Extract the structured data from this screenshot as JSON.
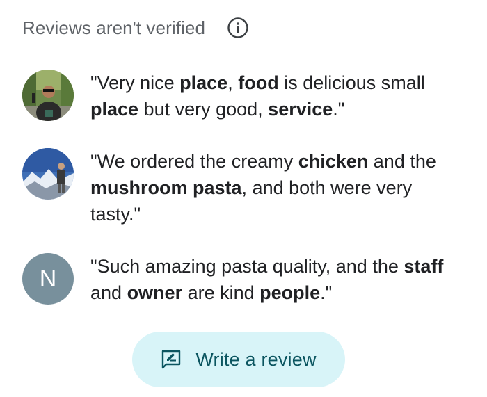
{
  "header": {
    "title": "Reviews aren't verified",
    "info_icon": "info-icon"
  },
  "reviews": [
    {
      "avatar": "photo",
      "parts": [
        {
          "t": "\"Very nice ",
          "b": false
        },
        {
          "t": "place",
          "b": true
        },
        {
          "t": ", ",
          "b": false
        },
        {
          "t": "food",
          "b": true
        },
        {
          "t": " is delicious small ",
          "b": false
        },
        {
          "t": "place",
          "b": true
        },
        {
          "t": " but very good, ",
          "b": false
        },
        {
          "t": "service",
          "b": true
        },
        {
          "t": ".\"",
          "b": false
        }
      ]
    },
    {
      "avatar": "photo",
      "parts": [
        {
          "t": "\"We ordered the creamy ",
          "b": false
        },
        {
          "t": "chicken",
          "b": true
        },
        {
          "t": " and the ",
          "b": false
        },
        {
          "t": "mushroom pasta",
          "b": true
        },
        {
          "t": ", and both were very tasty.\"",
          "b": false
        }
      ]
    },
    {
      "avatar": "letter",
      "avatar_letter": "N",
      "avatar_color": "#78909c",
      "parts": [
        {
          "t": "\"Such amazing pasta quality, and the ",
          "b": false
        },
        {
          "t": "staff",
          "b": true
        },
        {
          "t": " and ",
          "b": false
        },
        {
          "t": "owner",
          "b": true
        },
        {
          "t": " are kind ",
          "b": false
        },
        {
          "t": "people",
          "b": true
        },
        {
          "t": ".\"",
          "b": false
        }
      ]
    }
  ],
  "write_review": {
    "label": "Write a review",
    "icon": "rate-review-icon",
    "background": "#d8f4f8",
    "text_color": "#0b5560"
  }
}
